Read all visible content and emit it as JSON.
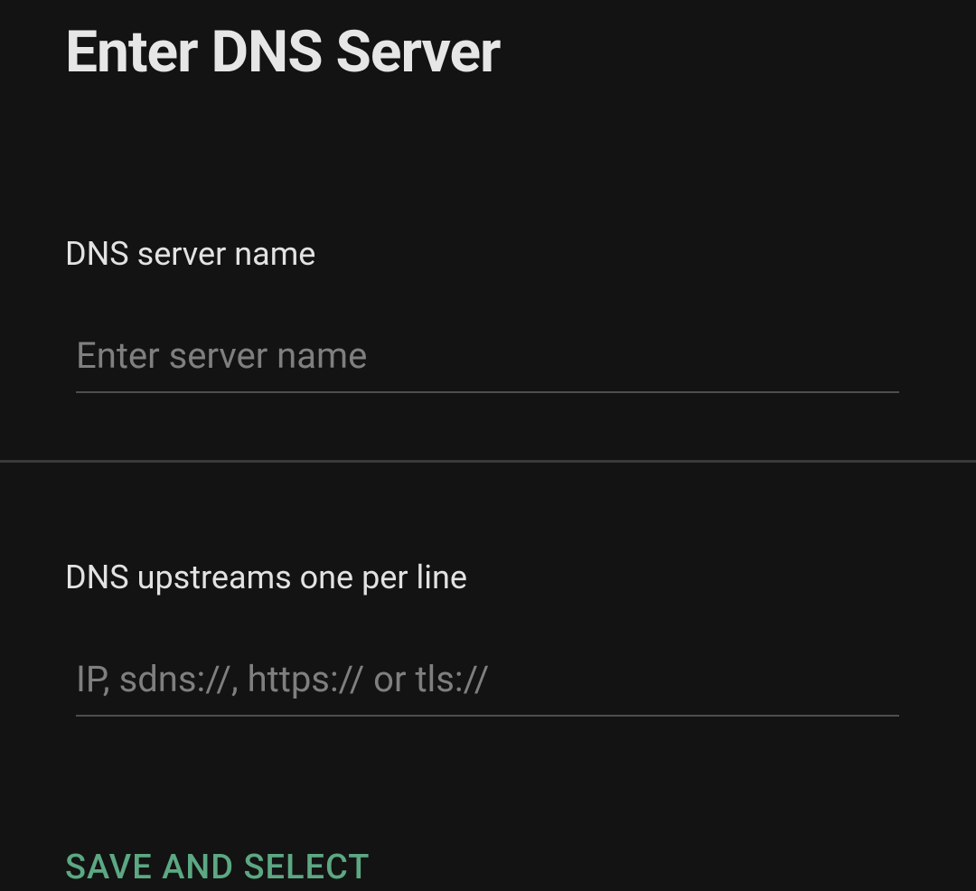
{
  "title": "Enter DNS Server",
  "fields": {
    "name": {
      "label": "DNS server name",
      "placeholder": "Enter server name",
      "value": ""
    },
    "upstreams": {
      "label": "DNS upstreams one per line",
      "placeholder": "IP, sdns://, https:// or tls://",
      "value": ""
    }
  },
  "actions": {
    "save_select": "SAVE AND SELECT"
  },
  "colors": {
    "background": "#131313",
    "text": "#e6e6e6",
    "placeholder": "#7f7f7f",
    "underline": "#4e4e4e",
    "divider": "#3a3a3a",
    "accent": "#5ca883"
  }
}
